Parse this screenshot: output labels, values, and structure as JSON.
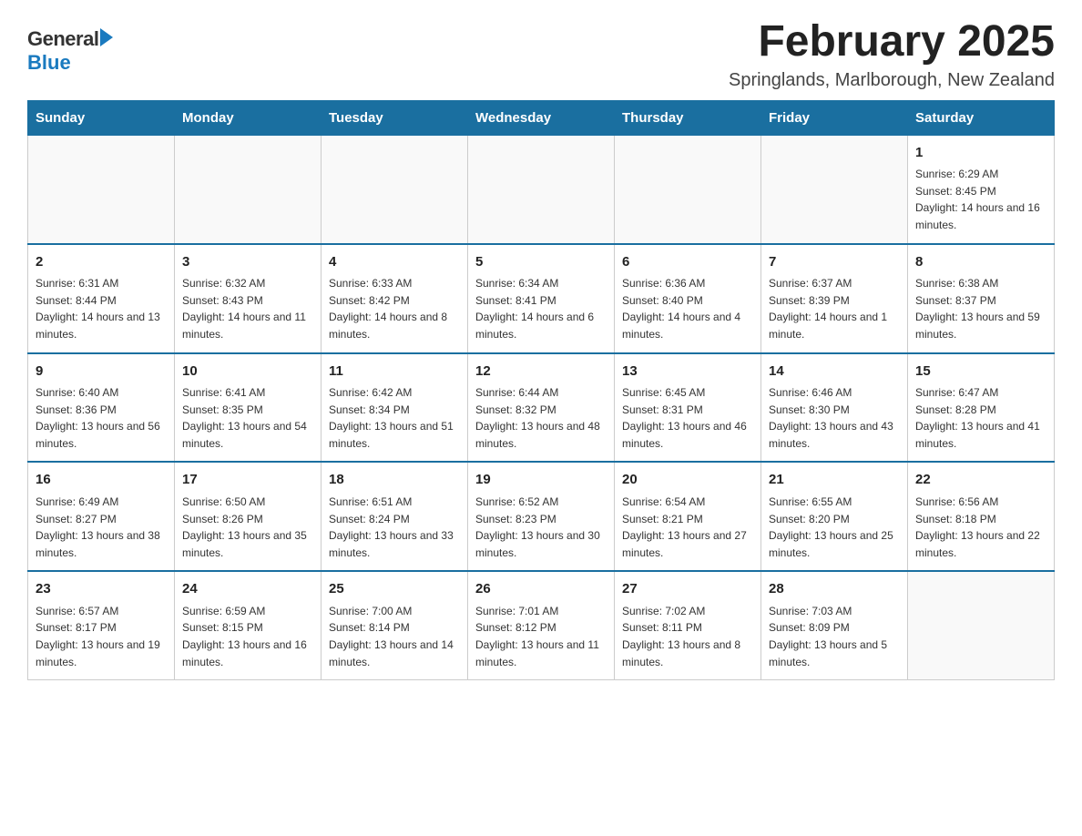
{
  "header": {
    "logo": {
      "general": "General",
      "blue": "Blue"
    },
    "title": "February 2025",
    "location": "Springlands, Marlborough, New Zealand"
  },
  "days_of_week": [
    "Sunday",
    "Monday",
    "Tuesday",
    "Wednesday",
    "Thursday",
    "Friday",
    "Saturday"
  ],
  "weeks": [
    [
      {
        "day": "",
        "info": ""
      },
      {
        "day": "",
        "info": ""
      },
      {
        "day": "",
        "info": ""
      },
      {
        "day": "",
        "info": ""
      },
      {
        "day": "",
        "info": ""
      },
      {
        "day": "",
        "info": ""
      },
      {
        "day": "1",
        "info": "Sunrise: 6:29 AM\nSunset: 8:45 PM\nDaylight: 14 hours and 16 minutes."
      }
    ],
    [
      {
        "day": "2",
        "info": "Sunrise: 6:31 AM\nSunset: 8:44 PM\nDaylight: 14 hours and 13 minutes."
      },
      {
        "day": "3",
        "info": "Sunrise: 6:32 AM\nSunset: 8:43 PM\nDaylight: 14 hours and 11 minutes."
      },
      {
        "day": "4",
        "info": "Sunrise: 6:33 AM\nSunset: 8:42 PM\nDaylight: 14 hours and 8 minutes."
      },
      {
        "day": "5",
        "info": "Sunrise: 6:34 AM\nSunset: 8:41 PM\nDaylight: 14 hours and 6 minutes."
      },
      {
        "day": "6",
        "info": "Sunrise: 6:36 AM\nSunset: 8:40 PM\nDaylight: 14 hours and 4 minutes."
      },
      {
        "day": "7",
        "info": "Sunrise: 6:37 AM\nSunset: 8:39 PM\nDaylight: 14 hours and 1 minute."
      },
      {
        "day": "8",
        "info": "Sunrise: 6:38 AM\nSunset: 8:37 PM\nDaylight: 13 hours and 59 minutes."
      }
    ],
    [
      {
        "day": "9",
        "info": "Sunrise: 6:40 AM\nSunset: 8:36 PM\nDaylight: 13 hours and 56 minutes."
      },
      {
        "day": "10",
        "info": "Sunrise: 6:41 AM\nSunset: 8:35 PM\nDaylight: 13 hours and 54 minutes."
      },
      {
        "day": "11",
        "info": "Sunrise: 6:42 AM\nSunset: 8:34 PM\nDaylight: 13 hours and 51 minutes."
      },
      {
        "day": "12",
        "info": "Sunrise: 6:44 AM\nSunset: 8:32 PM\nDaylight: 13 hours and 48 minutes."
      },
      {
        "day": "13",
        "info": "Sunrise: 6:45 AM\nSunset: 8:31 PM\nDaylight: 13 hours and 46 minutes."
      },
      {
        "day": "14",
        "info": "Sunrise: 6:46 AM\nSunset: 8:30 PM\nDaylight: 13 hours and 43 minutes."
      },
      {
        "day": "15",
        "info": "Sunrise: 6:47 AM\nSunset: 8:28 PM\nDaylight: 13 hours and 41 minutes."
      }
    ],
    [
      {
        "day": "16",
        "info": "Sunrise: 6:49 AM\nSunset: 8:27 PM\nDaylight: 13 hours and 38 minutes."
      },
      {
        "day": "17",
        "info": "Sunrise: 6:50 AM\nSunset: 8:26 PM\nDaylight: 13 hours and 35 minutes."
      },
      {
        "day": "18",
        "info": "Sunrise: 6:51 AM\nSunset: 8:24 PM\nDaylight: 13 hours and 33 minutes."
      },
      {
        "day": "19",
        "info": "Sunrise: 6:52 AM\nSunset: 8:23 PM\nDaylight: 13 hours and 30 minutes."
      },
      {
        "day": "20",
        "info": "Sunrise: 6:54 AM\nSunset: 8:21 PM\nDaylight: 13 hours and 27 minutes."
      },
      {
        "day": "21",
        "info": "Sunrise: 6:55 AM\nSunset: 8:20 PM\nDaylight: 13 hours and 25 minutes."
      },
      {
        "day": "22",
        "info": "Sunrise: 6:56 AM\nSunset: 8:18 PM\nDaylight: 13 hours and 22 minutes."
      }
    ],
    [
      {
        "day": "23",
        "info": "Sunrise: 6:57 AM\nSunset: 8:17 PM\nDaylight: 13 hours and 19 minutes."
      },
      {
        "day": "24",
        "info": "Sunrise: 6:59 AM\nSunset: 8:15 PM\nDaylight: 13 hours and 16 minutes."
      },
      {
        "day": "25",
        "info": "Sunrise: 7:00 AM\nSunset: 8:14 PM\nDaylight: 13 hours and 14 minutes."
      },
      {
        "day": "26",
        "info": "Sunrise: 7:01 AM\nSunset: 8:12 PM\nDaylight: 13 hours and 11 minutes."
      },
      {
        "day": "27",
        "info": "Sunrise: 7:02 AM\nSunset: 8:11 PM\nDaylight: 13 hours and 8 minutes."
      },
      {
        "day": "28",
        "info": "Sunrise: 7:03 AM\nSunset: 8:09 PM\nDaylight: 13 hours and 5 minutes."
      },
      {
        "day": "",
        "info": ""
      }
    ]
  ]
}
